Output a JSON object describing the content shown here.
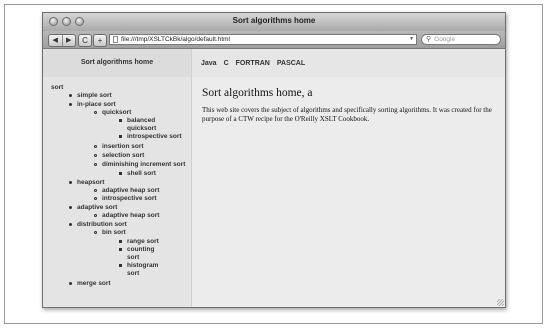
{
  "window": {
    "title": "Sort algorithms home"
  },
  "toolbar": {
    "back_glyph": "◀",
    "forward_glyph": "▶",
    "reload_glyph": "C",
    "add_glyph": "+",
    "url": "file:///tmp/XSLTCkBk/algo/default.html",
    "search_placeholder": "Google"
  },
  "sidebar": {
    "header": "Sort algorithms home",
    "root": "sort",
    "items": {
      "simple_sort": "simple sort",
      "in_place_sort": "in-place sort",
      "quicksort": "quicksort",
      "balanced_quicksort": "balanced quicksort",
      "introspective_sort_1": "introspective sort",
      "insertion_sort": "insertion sort",
      "selection_sort": "selection sort",
      "diminishing_increment_sort": "diminishing increment sort",
      "shell_sort": "shell sort",
      "heapsort": "heapsort",
      "adaptive_heap_sort_1": "adaptive heap sort",
      "introspective_sort_2": "introspective sort",
      "adaptive_sort": "adaptive sort",
      "adaptive_heap_sort_2": "adaptive heap sort",
      "distribution_sort": "distribution sort",
      "bin_sort": "bin sort",
      "range_sort": "range sort",
      "counting_sort": "counting sort",
      "histogram_sort": "histogram sort",
      "merge_sort": "merge sort"
    }
  },
  "topnav": {
    "items": [
      "Java",
      "C",
      "FORTRAN",
      "PASCAL"
    ]
  },
  "main": {
    "title": "Sort algorithms home, a",
    "body": "This web site covers the subject of algorithms and specifically sorting algorithms. It was created for the purpose of a CTW recipe for the O'Reilly XSLT Cookbook."
  }
}
